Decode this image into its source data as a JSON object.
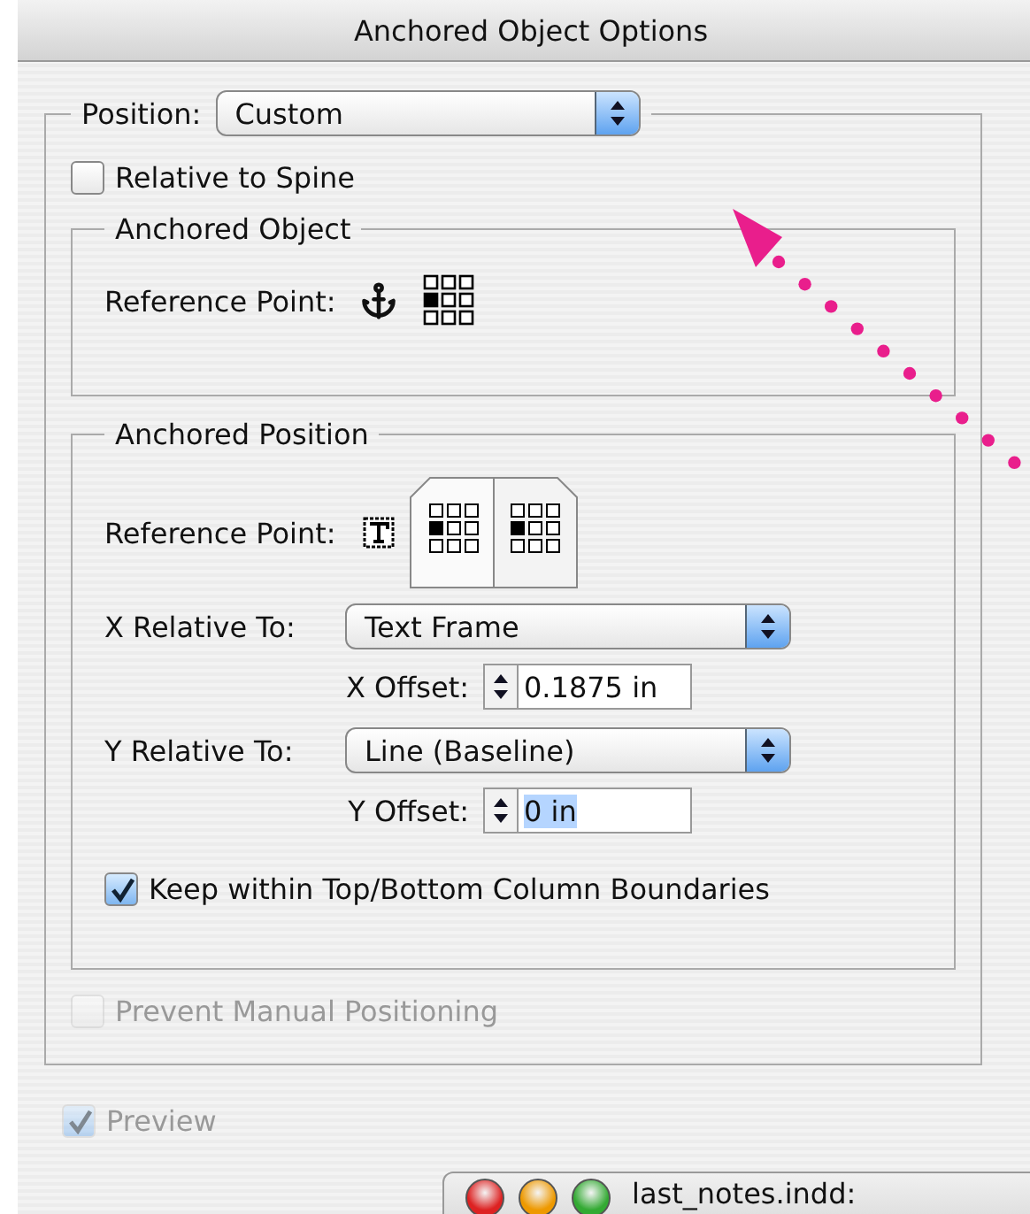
{
  "window": {
    "title": "Anchored Object Options"
  },
  "position": {
    "label": "Position:",
    "value": "Custom"
  },
  "relative_to_spine": {
    "label": "Relative to Spine",
    "checked": false,
    "disabled": false
  },
  "anchored_object": {
    "title": "Anchored Object",
    "reference_point_label": "Reference Point:"
  },
  "anchored_position": {
    "title": "Anchored Position",
    "reference_point_label": "Reference Point:",
    "x_relative": {
      "label": "X Relative To:",
      "value": "Text Frame"
    },
    "x_offset": {
      "label": "X Offset:",
      "value": "0.1875 in",
      "selected": false
    },
    "y_relative": {
      "label": "Y Relative To:",
      "value": "Line (Baseline)"
    },
    "y_offset": {
      "label": "Y Offset:",
      "value": "0 in",
      "selected": true
    },
    "keep_within": {
      "label": "Keep within Top/Bottom Column Boundaries",
      "checked": true,
      "disabled": false
    }
  },
  "prevent_manual": {
    "label": "Prevent Manual Positioning",
    "checked": false,
    "disabled": true
  },
  "preview": {
    "label": "Preview",
    "checked": true,
    "disabled": true
  },
  "background_window": {
    "title": "last_notes.indd:"
  }
}
